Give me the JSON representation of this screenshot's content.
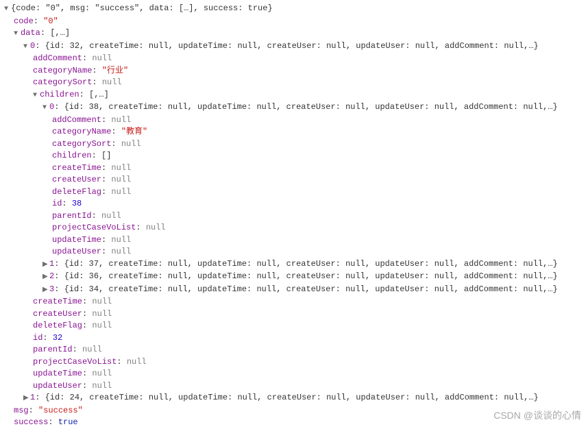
{
  "root_preview": "{code: \"0\", msg: \"success\", data: […], success: true}",
  "code_key": "code",
  "code_val": "\"0\"",
  "data_key": "data",
  "array_preview": "[,…]",
  "data0_idx": "0",
  "data0_preview": "{id: 32, createTime: null, updateTime: null, createUser: null, updateUser: null, addComment: null,…}",
  "addComment_key": "addComment",
  "categoryName_key": "categoryName",
  "categoryName_val0": "\"行业\"",
  "categorySort_key": "categorySort",
  "children_key": "children",
  "children0_idx": "0",
  "children0_preview": "{id: 38, createTime: null, updateTime: null, createUser: null, updateUser: null, addComment: null,…}",
  "categoryName_val_child": "\"教育\"",
  "children_empty": "[]",
  "createTime_key": "createTime",
  "createUser_key": "createUser",
  "deleteFlag_key": "deleteFlag",
  "id_key": "id",
  "id_val_child": "38",
  "parentId_key": "parentId",
  "projectCaseVoList_key": "projectCaseVoList",
  "updateTime_key": "updateTime",
  "updateUser_key": "updateUser",
  "children1_idx": "1",
  "children1_preview": "{id: 37, createTime: null, updateTime: null, createUser: null, updateUser: null, addComment: null,…}",
  "children2_idx": "2",
  "children2_preview": "{id: 36, createTime: null, updateTime: null, createUser: null, updateUser: null, addComment: null,…}",
  "children3_idx": "3",
  "children3_preview": "{id: 34, createTime: null, updateTime: null, createUser: null, updateUser: null, addComment: null,…}",
  "id_val_parent": "32",
  "data1_idx": "1",
  "data1_preview": "{id: 24, createTime: null, updateTime: null, createUser: null, updateUser: null, addComment: null,…}",
  "msg_key": "msg",
  "msg_val": "\"success\"",
  "success_key": "success",
  "success_val": "true",
  "null_val": "null",
  "watermark": "CSDN @谈谈的心情"
}
